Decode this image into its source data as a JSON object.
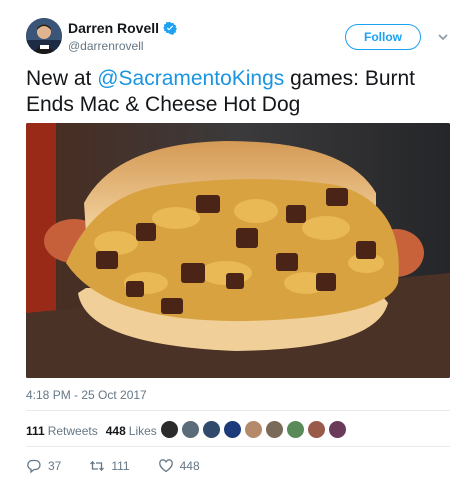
{
  "author": {
    "name": "Darren Rovell",
    "handle": "@darrenrovell",
    "verified": true
  },
  "follow_label": "Follow",
  "tweet": {
    "prefix": "New at ",
    "mention": "@SacramentoKings",
    "suffix": " games: Burnt Ends Mac & Cheese Hot Dog"
  },
  "timestamp": "4:18 PM - 25 Oct 2017",
  "stats": {
    "retweets_count": "111",
    "retweets_label": "Retweets",
    "likes_count": "448",
    "likes_label": "Likes"
  },
  "actions": {
    "reply_count": "37",
    "retweet_count": "111",
    "like_count": "448"
  },
  "icons": {
    "verified": "verified-badge-icon",
    "caret": "chevron-down-icon",
    "reply": "reply-icon",
    "retweet": "retweet-icon",
    "like": "heart-icon"
  },
  "colors": {
    "accent": "#1da1f2",
    "mention": "#1b95e0",
    "muted": "#657786"
  }
}
